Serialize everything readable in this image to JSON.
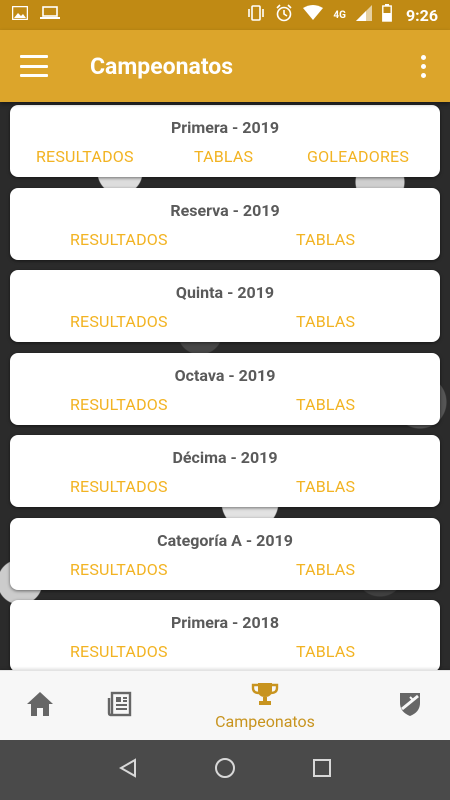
{
  "status_bar": {
    "network_label": "4G",
    "time": "9:26"
  },
  "app_bar": {
    "title": "Campeonatos"
  },
  "cards": [
    {
      "title": "Primera - 2019",
      "results_label": "RESULTADOS",
      "tables_label": "TABLAS",
      "scorers_label": "GOLEADORES"
    },
    {
      "title": "Reserva - 2019",
      "results_label": "RESULTADOS",
      "tables_label": "TABLAS"
    },
    {
      "title": "Quinta - 2019",
      "results_label": "RESULTADOS",
      "tables_label": "TABLAS"
    },
    {
      "title": "Octava - 2019",
      "results_label": "RESULTADOS",
      "tables_label": "TABLAS"
    },
    {
      "title": "Décima - 2019",
      "results_label": "RESULTADOS",
      "tables_label": "TABLAS"
    },
    {
      "title": "Categoría A - 2019",
      "results_label": "RESULTADOS",
      "tables_label": "TABLAS"
    },
    {
      "title": "Primera - 2018",
      "results_label": "RESULTADOS",
      "tables_label": "TABLAS"
    }
  ],
  "bottom_nav": {
    "active_label": "Campeonatos",
    "items": [
      "home-icon",
      "news-icon",
      "trophy-icon",
      "shield-icon"
    ]
  },
  "colors": {
    "primary": "#dca52b",
    "status_bar": "#c08a14",
    "link": "#f2b322",
    "active_nav": "#c8941f"
  }
}
